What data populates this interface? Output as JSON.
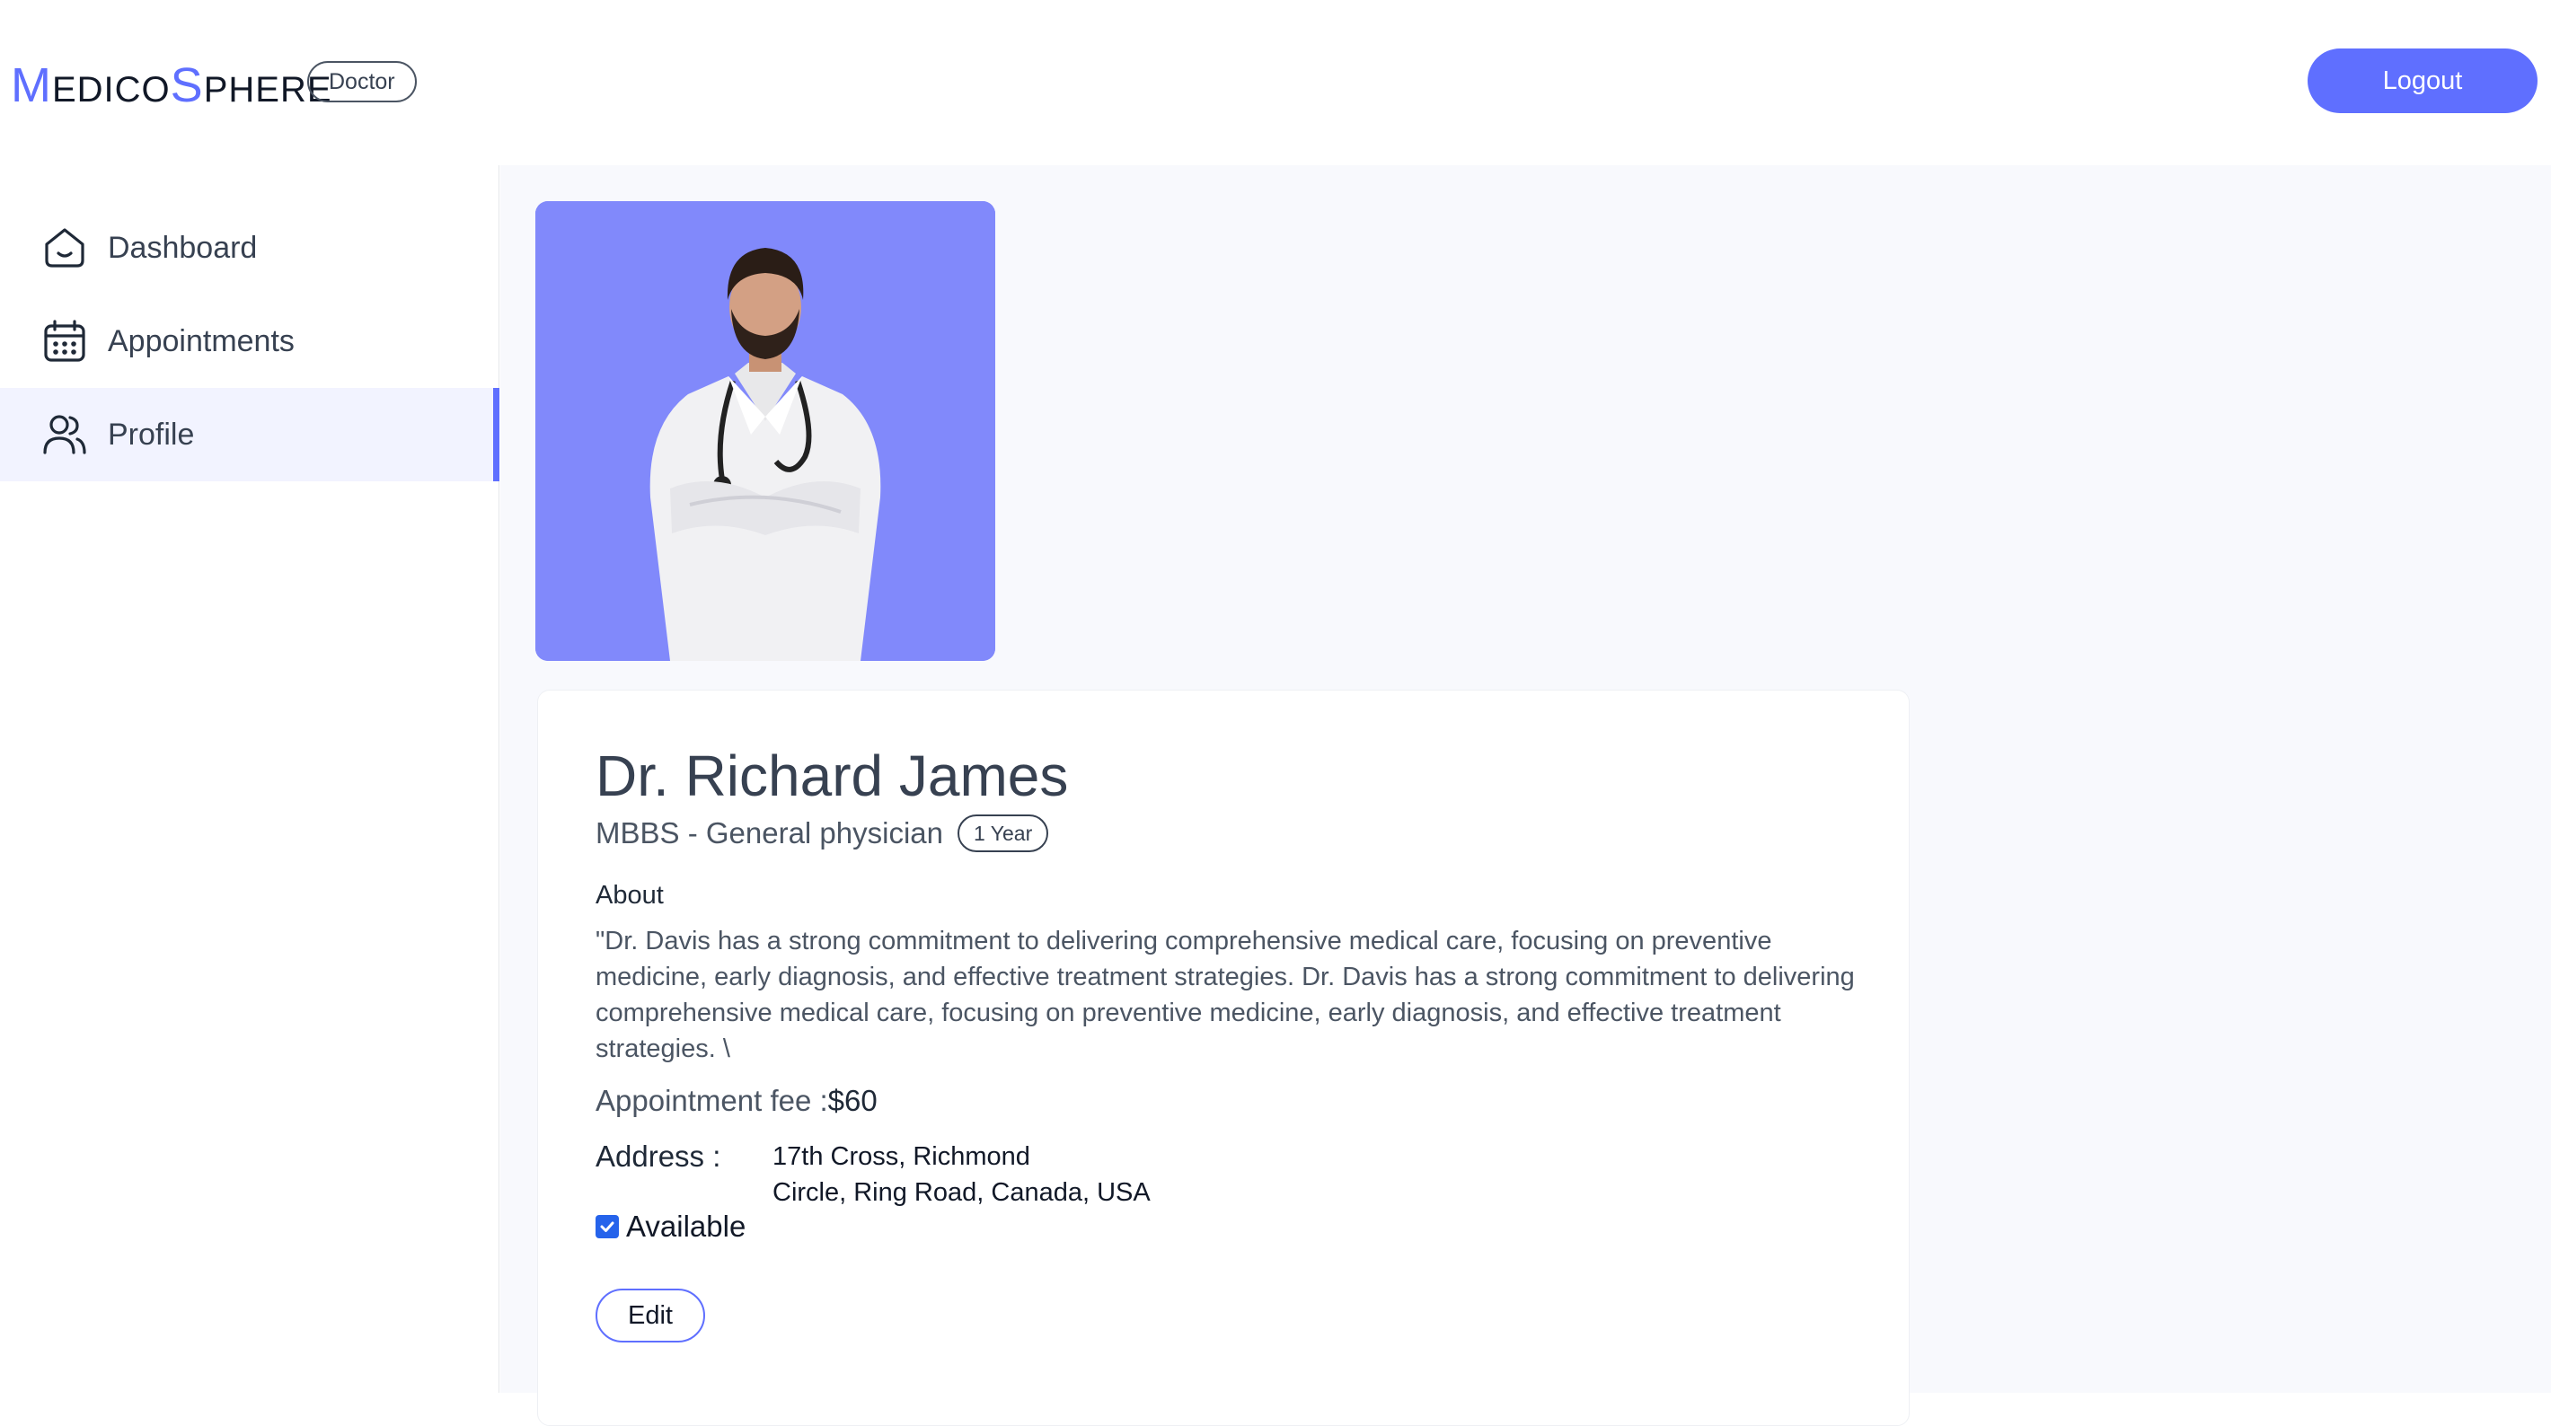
{
  "header": {
    "logo_first_cap": "M",
    "logo_first_rest": "EDICO",
    "logo_second_cap": "S",
    "logo_second_rest": "PHERE",
    "role_badge": "Doctor",
    "logout_label": "Logout"
  },
  "sidebar": {
    "items": [
      {
        "label": "Dashboard",
        "icon": "home-icon",
        "active": false
      },
      {
        "label": "Appointments",
        "icon": "calendar-icon",
        "active": false
      },
      {
        "label": "Profile",
        "icon": "people-icon",
        "active": true
      }
    ]
  },
  "profile": {
    "photo_alt": "doctor-photo",
    "name": "Dr. Richard James",
    "degree": "MBBS - General physician",
    "experience": "1 Year",
    "about_title": "About",
    "about_text": "\"Dr. Davis has a strong commitment to delivering comprehensive medical care, focusing on preventive medicine, early diagnosis, and effective treatment strategies. Dr. Davis has a strong commitment to delivering comprehensive medical care, focusing on preventive medicine, early diagnosis, and effective treatment strategies. \\",
    "fee_label": "Appointment fee :",
    "fee_value": "$60",
    "address_label": "Address :",
    "address_line1": "17th Cross, Richmond",
    "address_line2": "Circle, Ring Road, Canada, USA",
    "available_label": "Available",
    "available": true,
    "edit_label": "Edit"
  },
  "colors": {
    "accent": "#5f6fff",
    "photo_bg": "#8189fb",
    "main_bg": "#f8f9fd",
    "active_nav_bg": "#f2f3ff"
  }
}
